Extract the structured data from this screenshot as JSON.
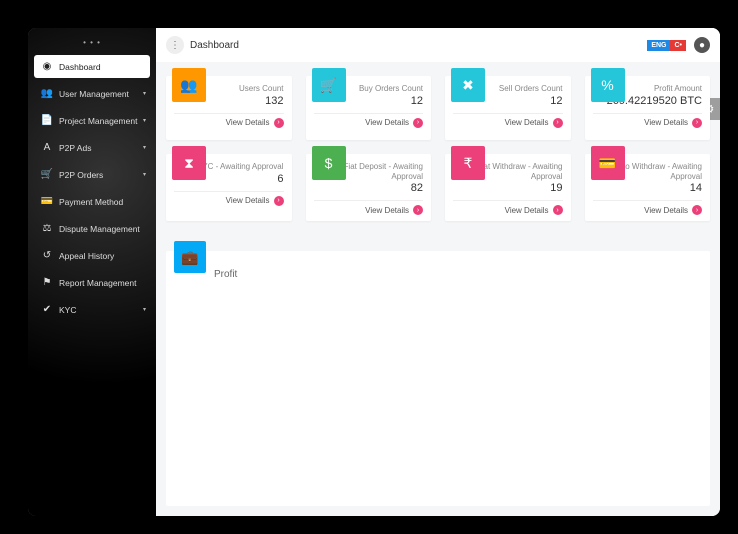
{
  "header": {
    "breadcrumb": "Dashboard",
    "lang_primary": "ENG",
    "lang_secondary": "C•"
  },
  "sidebar": {
    "items": [
      {
        "label": "Dashboard",
        "has_caret": false,
        "active": true,
        "icon": "◉"
      },
      {
        "label": "User Management",
        "has_caret": true,
        "active": false,
        "icon": "👥"
      },
      {
        "label": "Project Management",
        "has_caret": true,
        "active": false,
        "icon": "📄"
      },
      {
        "label": "P2P Ads",
        "has_caret": true,
        "active": false,
        "icon": "A"
      },
      {
        "label": "P2P Orders",
        "has_caret": true,
        "active": false,
        "icon": "🛒"
      },
      {
        "label": "Payment Method",
        "has_caret": false,
        "active": false,
        "icon": "💳"
      },
      {
        "label": "Dispute Management",
        "has_caret": false,
        "active": false,
        "icon": "⚖"
      },
      {
        "label": "Appeal History",
        "has_caret": false,
        "active": false,
        "icon": "↺"
      },
      {
        "label": "Report Management",
        "has_caret": false,
        "active": false,
        "icon": "⚑"
      },
      {
        "label": "KYC",
        "has_caret": true,
        "active": false,
        "icon": "✔"
      }
    ]
  },
  "cards": [
    {
      "label": "Users Count",
      "value": "132",
      "color": "orange",
      "icon": "👥",
      "footer": "View Details"
    },
    {
      "label": "Buy Orders Count",
      "value": "12",
      "color": "teal",
      "icon": "🛒",
      "footer": "View Details"
    },
    {
      "label": "Sell Orders Count",
      "value": "12",
      "color": "teal",
      "icon": "✖",
      "footer": "View Details"
    },
    {
      "label": "Profit Amount",
      "value": "269.42219520 BTC",
      "color": "teal",
      "icon": "%",
      "footer": "View Details"
    },
    {
      "label": "KYC - Awaiting Approval",
      "value": "6",
      "color": "pink",
      "icon": "⧗",
      "footer": "View Details"
    },
    {
      "label": "Fiat Deposit - Awaiting Approval",
      "value": "82",
      "color": "green",
      "icon": "$",
      "footer": "View Details"
    },
    {
      "label": "Fiat Withdraw - Awaiting Approval",
      "value": "19",
      "color": "pink",
      "icon": "₹",
      "footer": "View Details"
    },
    {
      "label": "Crypto Withdraw - Awaiting Approval",
      "value": "14",
      "color": "pink",
      "icon": "💳",
      "footer": "View Details"
    }
  ],
  "profit_panel": {
    "title": "Profit",
    "icon": "💼"
  }
}
